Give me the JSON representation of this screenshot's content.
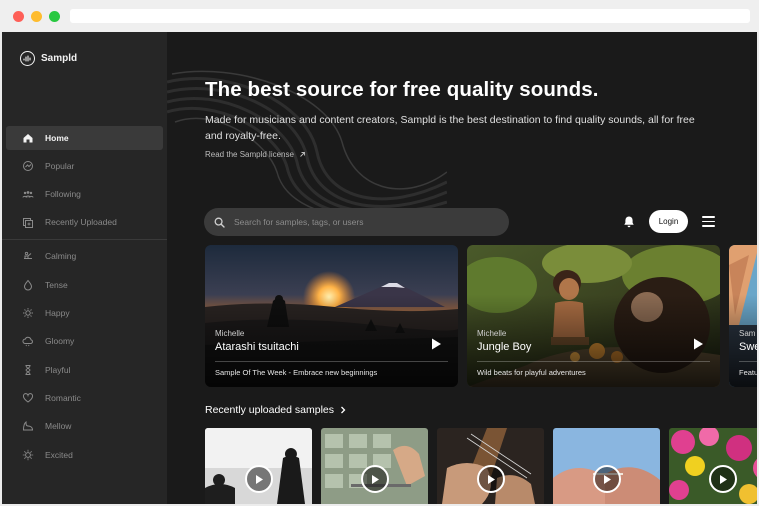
{
  "app": {
    "brand": "Sampld"
  },
  "sidebar": {
    "items": [
      {
        "label": "Home",
        "icon": "home-icon",
        "active": true
      },
      {
        "label": "Popular",
        "icon": "popular-icon"
      },
      {
        "label": "Following",
        "icon": "following-icon"
      },
      {
        "label": "Recently Uploaded",
        "icon": "upload-icon"
      },
      {
        "label": "Calming",
        "icon": "calming-icon"
      },
      {
        "label": "Tense",
        "icon": "tense-icon"
      },
      {
        "label": "Happy",
        "icon": "happy-icon"
      },
      {
        "label": "Gloomy",
        "icon": "gloomy-icon"
      },
      {
        "label": "Playful",
        "icon": "playful-icon"
      },
      {
        "label": "Romantic",
        "icon": "heart-icon"
      },
      {
        "label": "Mellow",
        "icon": "mellow-icon"
      },
      {
        "label": "Excited",
        "icon": "excited-icon"
      }
    ]
  },
  "hero": {
    "title": "The best source for free quality sounds.",
    "subtitle": "Made for musicians and content creators, Sampld is the best destination to find quality sounds, all for free and royalty-free.",
    "license_link": "Read the Sampld license"
  },
  "header": {
    "search_placeholder": "Search for samples, tags, or users",
    "login_label": "Login"
  },
  "featured": [
    {
      "artist": "Michelle",
      "title": "Atarashi tsuitachi",
      "description": "Sample Of The Week - Embrace new beginnings"
    },
    {
      "artist": "Michelle",
      "title": "Jungle Boy",
      "description": "Wild beats for playful adventures"
    },
    {
      "artist": "Sam",
      "title": "Swe",
      "description": "Featu"
    }
  ],
  "recent": {
    "title": "Recently uploaded samples"
  },
  "colors": {
    "background": "#1a1a1a",
    "sidebar": "#262626",
    "accent": "#ffffff"
  }
}
